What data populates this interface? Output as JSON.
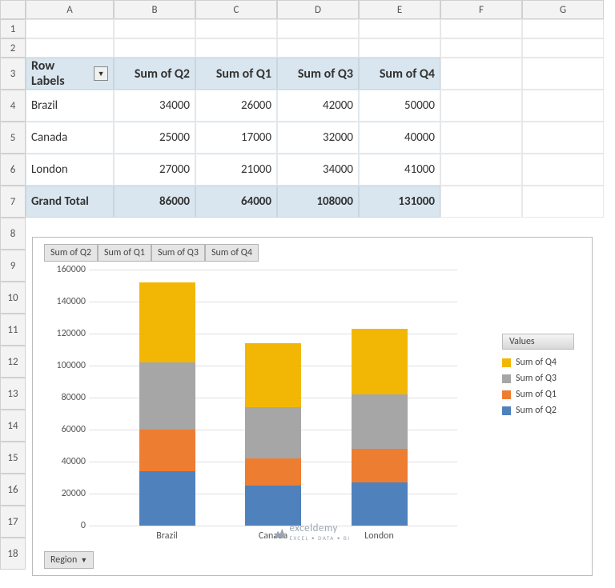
{
  "columns": [
    "A",
    "B",
    "C",
    "D",
    "E",
    "F",
    "G"
  ],
  "rows": [
    "1",
    "2",
    "3",
    "4",
    "5",
    "6",
    "7",
    "8",
    "9",
    "10",
    "11",
    "12",
    "13",
    "14",
    "15",
    "16",
    "17",
    "18"
  ],
  "pivot": {
    "row_labels_header": "Row Labels",
    "col_headers": [
      "Sum of Q2",
      "Sum of Q1",
      "Sum of Q3",
      "Sum of Q4"
    ],
    "rows": [
      {
        "label": "Brazil",
        "vals": [
          "34000",
          "26000",
          "42000",
          "50000"
        ]
      },
      {
        "label": "Canada",
        "vals": [
          "25000",
          "17000",
          "32000",
          "40000"
        ]
      },
      {
        "label": "London",
        "vals": [
          "27000",
          "21000",
          "34000",
          "41000"
        ]
      }
    ],
    "total_label": "Grand Total",
    "totals": [
      "86000",
      "64000",
      "108000",
      "131000"
    ]
  },
  "chart_buttons": [
    "Sum of Q2",
    "Sum of Q1",
    "Sum of Q3",
    "Sum of Q4"
  ],
  "region_label": "Region",
  "legend_title": "Values",
  "legend": [
    {
      "label": "Sum of Q4",
      "color": "#f2b705"
    },
    {
      "label": "Sum of Q3",
      "color": "#a6a6a6"
    },
    {
      "label": "Sum of Q1",
      "color": "#ed7d31"
    },
    {
      "label": "Sum of Q2",
      "color": "#4f81bd"
    }
  ],
  "yticks": [
    "0",
    "20000",
    "40000",
    "60000",
    "80000",
    "100000",
    "120000",
    "140000",
    "160000"
  ],
  "watermark": {
    "brand": "exceldemy",
    "sub": "EXCEL • DATA • BI"
  },
  "chart_data": {
    "type": "bar",
    "stacked": true,
    "title": "",
    "xlabel": "",
    "ylabel": "",
    "ylim": [
      0,
      160000
    ],
    "categories": [
      "Brazil",
      "Canada",
      "London"
    ],
    "series": [
      {
        "name": "Sum of Q2",
        "color": "#4f81bd",
        "values": [
          34000,
          25000,
          27000
        ]
      },
      {
        "name": "Sum of Q1",
        "color": "#ed7d31",
        "values": [
          26000,
          17000,
          21000
        ]
      },
      {
        "name": "Sum of Q3",
        "color": "#a6a6a6",
        "values": [
          42000,
          32000,
          34000
        ]
      },
      {
        "name": "Sum of Q4",
        "color": "#f2b705",
        "values": [
          50000,
          40000,
          41000
        ]
      }
    ],
    "legend_position": "right",
    "grid": true
  }
}
